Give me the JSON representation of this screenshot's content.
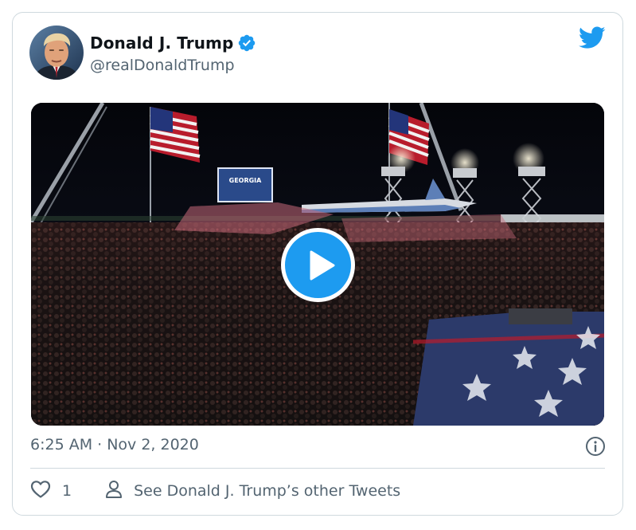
{
  "tweet": {
    "author": {
      "display_name": "Donald J. Trump",
      "handle": "@realDonaldTrump",
      "verified": true
    },
    "timestamp": "6:25 AM · Nov 2, 2020",
    "like_count": "1",
    "profile_link_label": "See Donald J. Trump’s other Tweets"
  },
  "media": {
    "type": "video",
    "signage_text": "GEORGIA"
  },
  "icons": {
    "brand": "twitter-bird-icon",
    "verified": "verified-badge-icon",
    "play": "play-icon",
    "info": "info-icon",
    "like": "heart-icon",
    "profile": "person-icon"
  },
  "colors": {
    "accent": "#1d9bf0",
    "text_primary": "#0f1419",
    "text_secondary": "#536471",
    "border": "#cfd9de"
  }
}
